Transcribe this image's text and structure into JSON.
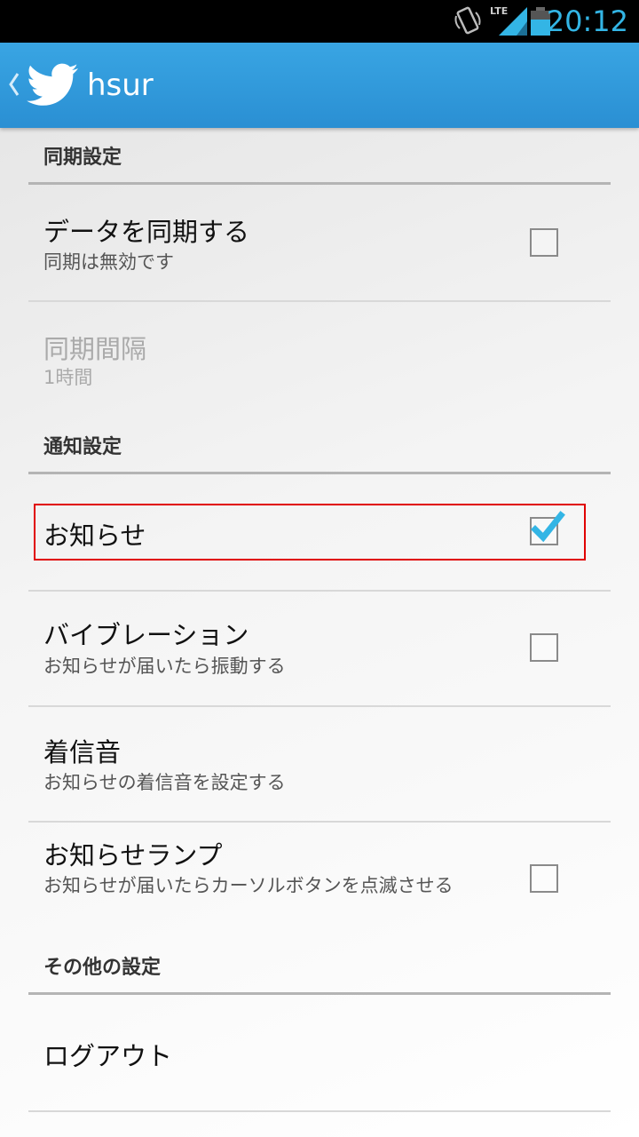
{
  "status_bar": {
    "network": "LTE",
    "time": "20:12",
    "icons": [
      "rotation-lock-icon",
      "lte-signal-icon",
      "battery-icon"
    ]
  },
  "action_bar": {
    "title": "hsur",
    "icons": [
      "up-chevron-icon",
      "twitter-bird-icon"
    ]
  },
  "sync_section": {
    "header": "同期設定",
    "sync_data": {
      "title": "データを同期する",
      "summary": "同期は無効です",
      "checked": false
    },
    "sync_interval": {
      "title": "同期間隔",
      "summary": "1時間",
      "enabled": false
    }
  },
  "notification_section": {
    "header": "通知設定",
    "notifications": {
      "title": "お知らせ",
      "checked": true
    },
    "vibration": {
      "title": "バイブレーション",
      "summary": "お知らせが届いたら振動する",
      "checked": false
    },
    "ringtone": {
      "title": "着信音",
      "summary": "お知らせの着信音を設定する"
    },
    "notification_lamp": {
      "title": "お知らせランプ",
      "summary": "お知らせが届いたらカーソルボタンを点滅させる",
      "checked": false
    }
  },
  "other_section": {
    "header": "その他の設定",
    "logout": {
      "title": "ログアウト"
    }
  },
  "colors": {
    "action_bar": "#2a8fd3",
    "status_time": "#33b5e5",
    "checkmark": "#33b5e5",
    "highlight": "#e00000"
  }
}
